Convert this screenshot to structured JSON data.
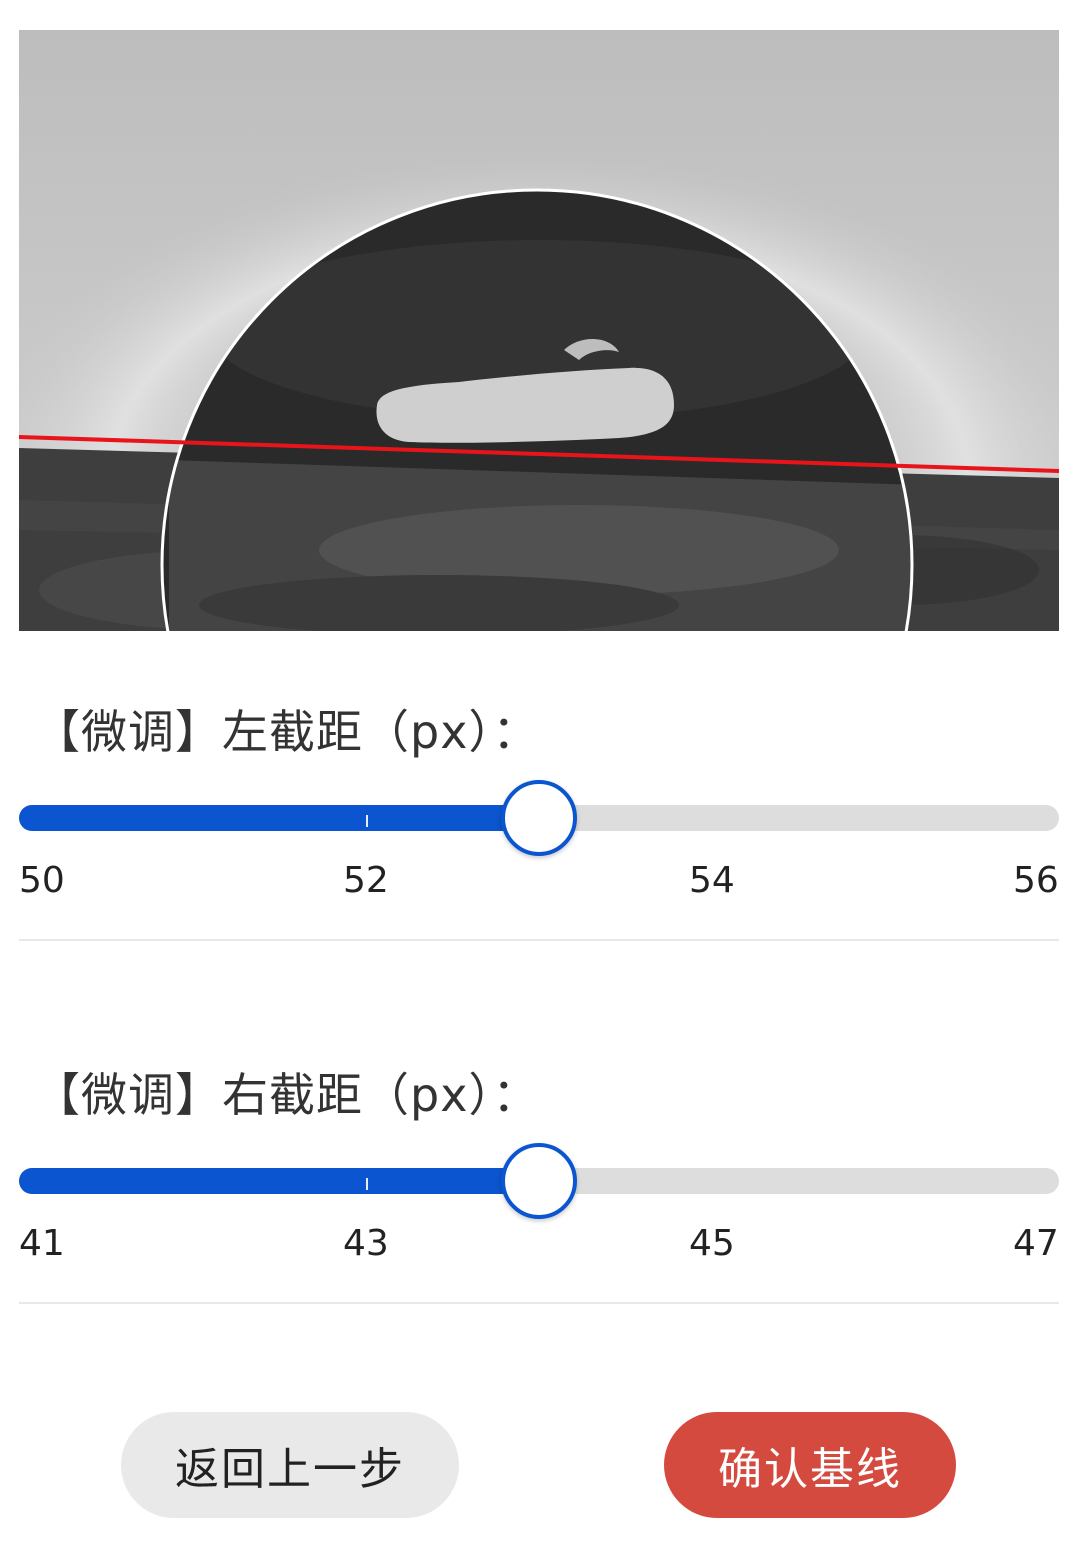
{
  "image_preview": {
    "description_icon": "droplet-photo",
    "baseline_color": "#e8141a",
    "circle_color": "#ffffff"
  },
  "left_slider": {
    "label": "【微调】左截距（px）：",
    "min": 50,
    "max": 56,
    "value": 53,
    "ticks": [
      "50",
      "52",
      "54",
      "56"
    ],
    "accent": "#0b55d0"
  },
  "right_slider": {
    "label": "【微调】右截距（px）：",
    "min": 41,
    "max": 47,
    "value": 44,
    "ticks": [
      "41",
      "43",
      "45",
      "47"
    ],
    "accent": "#0b55d0"
  },
  "buttons": {
    "back_label": "返回上一步",
    "confirm_label": "确认基线",
    "confirm_color": "#d54a3f"
  }
}
